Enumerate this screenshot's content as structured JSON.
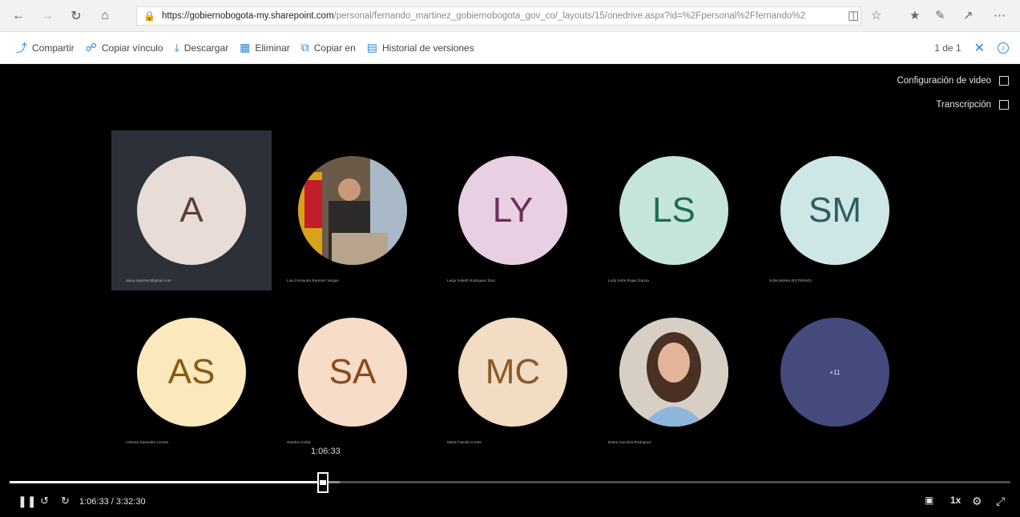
{
  "browser": {
    "url_host": "https://gobiernobogota-my.sharepoint.com",
    "url_tail": "/personal/fernando_martinez_gobiernobogota_gov_co/_layouts/15/onedrive.aspx?id=%2Fpersonal%2Ffernando%2",
    "icons": [
      "back-icon",
      "forward-icon",
      "refresh-icon",
      "home-icon",
      "lock-icon",
      "reading-view-icon",
      "favorite-star-icon",
      "favorites-icon",
      "pen-icon",
      "share-icon",
      "more-icon"
    ]
  },
  "toolbar": {
    "share": "Compartir",
    "copy_link": "Copiar vínculo",
    "download": "Descargar",
    "delete": "Eliminar",
    "copy_to": "Copiar en",
    "version_history": "Historial de versiones",
    "page_count": "1 de 1"
  },
  "video": {
    "settings_label": "Configuración de video",
    "transcript_label": "Transcripción",
    "participants": [
      {
        "initials": "A",
        "name": "alexa.martinez@gmail.com",
        "bg": "#e8dcd7",
        "fg": "#5a3f36",
        "active": true
      },
      {
        "initials": "",
        "name": "Luis Fernando Ramirez Vargas",
        "bg": "#5c4a3a",
        "fg": "#ffffff",
        "photo": "speaker"
      },
      {
        "initials": "LY",
        "name": "Leidy Yulieth Rodriguez Diaz",
        "bg": "#e9cfe3",
        "fg": "#6b2f5a"
      },
      {
        "initials": "LS",
        "name": "Ledy Sofia Rojas Garcia",
        "bg": "#c6e5da",
        "fg": "#1f6b52"
      },
      {
        "initials": "SM",
        "name": "Sofia Molina (EXTERNO)",
        "bg": "#cfe6e6",
        "fg": "#2e5e63"
      },
      {
        "initials": "AS",
        "name": "Adriana Saavedra Acosta",
        "bg": "#fce8bd",
        "fg": "#8a5a12"
      },
      {
        "initials": "SA",
        "name": "Sandra Acuña",
        "bg": "#f7dcc7",
        "fg": "#8a4a1c"
      },
      {
        "initials": "MC",
        "name": "Maria Camila Cortes",
        "bg": "#f3dcc4",
        "fg": "#8a5a2a"
      },
      {
        "initials": "",
        "name": "Diana Carolina Rodriguez",
        "bg": "#c9b7a5",
        "fg": "#ffffff",
        "photo": "woman"
      },
      {
        "initials": "+11",
        "name": "",
        "bg": "#454a7d",
        "fg": "#e6e6f0"
      }
    ],
    "hover_time": "1:06:33",
    "current_time": "1:06:33",
    "total_time": "3:32:30",
    "time_display": "1:06:33 / 3:32:30",
    "progress_fraction": 0.313,
    "buffer_fraction": 0.33,
    "speed": "1x"
  }
}
